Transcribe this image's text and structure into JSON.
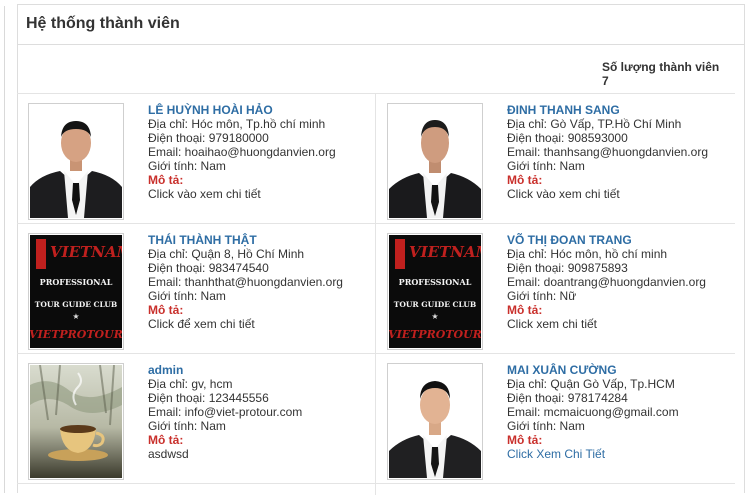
{
  "panel": {
    "title": "Hệ thống thành viên",
    "count_label": "Số lượng thành viên",
    "count_value": "7"
  },
  "members": [
    {
      "name": "LÊ HUỲNH HOÀI HẢO",
      "address": "Địa chỉ: Hóc môn, Tp.hồ chí minh",
      "phone": "Điện thoại: 979180000",
      "email": "Email: hoaihao@huongdanvien.org",
      "gender": "Giới tính: Nam",
      "desc_label": "Mô tả:",
      "desc": "Click vào xem chi tiết",
      "photo": "portrait-man-suit"
    },
    {
      "name": "ĐINH THANH SANG",
      "address": "Địa chỉ: Gò Vấp, TP.Hồ Chí Minh",
      "phone": "Điện thoại: 908593000",
      "email": "Email: thanhsang@huongdanvien.org",
      "gender": "Giới tính: Nam",
      "desc_label": "Mô tả:",
      "desc": "Click vào xem chi tiết",
      "photo": "portrait-man-suit"
    },
    {
      "name": "THÁI THÀNH THẬT",
      "address": "Địa chỉ: Quận 8, Hồ Chí Minh",
      "phone": "Điện thoại: 983474540",
      "email": "Email: thanhthat@huongdanvien.org",
      "gender": "Giới tính: Nam",
      "desc_label": "Mô tả:",
      "desc": "Click để xem chi tiết",
      "photo": "vietprotour-logo"
    },
    {
      "name": "VÕ THỊ ĐOAN TRANG",
      "address": "Địa chỉ: Hóc môn, hồ chí minh",
      "phone": "Điện thoại: 909875893",
      "email": "Email: doantrang@huongdanvien.org",
      "gender": "Giới tính: Nữ",
      "desc_label": "Mô tả:",
      "desc": "Click xem chi tiết",
      "photo": "vietprotour-logo"
    },
    {
      "name": "admin",
      "address": "Địa chỉ: gv, hcm",
      "phone": "Điện thoại: 123445556",
      "email": "Email: info@viet-protour.com",
      "gender": "Giới tính: Nam",
      "desc_label": "Mô tả:",
      "desc": "asdwsd",
      "photo": "coffee-cup"
    },
    {
      "name": "MAI XUÂN CƯỜNG",
      "address": "Địa chỉ: Quận Gò Vấp, Tp.HCM",
      "phone": "Điện thoại: 978174284",
      "email": "Email: mcmaicuong@gmail.com",
      "gender": "Giới tính: Nam",
      "desc_label": "Mô tả:",
      "desc": "Click Xem Chi Tiết",
      "photo": "portrait-man-suit"
    }
  ],
  "logo": {
    "line1": "VIETNAM",
    "line2": "PROFESSIONAL",
    "line3": "TOUR GUIDE CLUB",
    "line4": "VIETPROTOUR"
  },
  "colors": {
    "name_link": "#2e6da4",
    "desc_label": "#c9302c",
    "logo_red": "#c0201e"
  }
}
